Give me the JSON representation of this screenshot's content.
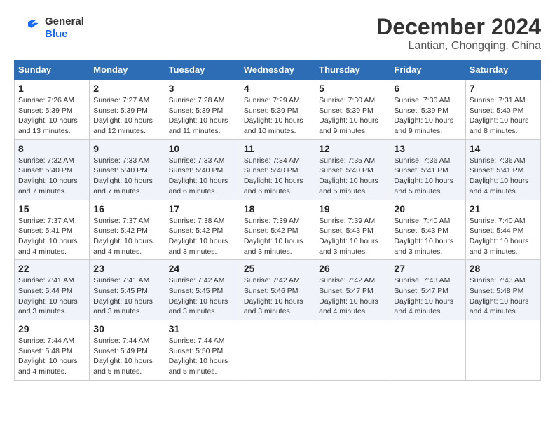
{
  "header": {
    "logo_line1": "General",
    "logo_line2": "Blue",
    "month": "December 2024",
    "location": "Lantian, Chongqing, China"
  },
  "weekdays": [
    "Sunday",
    "Monday",
    "Tuesday",
    "Wednesday",
    "Thursday",
    "Friday",
    "Saturday"
  ],
  "weeks": [
    [
      {
        "day": "1",
        "sunrise": "7:26 AM",
        "sunset": "5:39 PM",
        "daylight": "10 hours and 13 minutes."
      },
      {
        "day": "2",
        "sunrise": "7:27 AM",
        "sunset": "5:39 PM",
        "daylight": "10 hours and 12 minutes."
      },
      {
        "day": "3",
        "sunrise": "7:28 AM",
        "sunset": "5:39 PM",
        "daylight": "10 hours and 11 minutes."
      },
      {
        "day": "4",
        "sunrise": "7:29 AM",
        "sunset": "5:39 PM",
        "daylight": "10 hours and 10 minutes."
      },
      {
        "day": "5",
        "sunrise": "7:30 AM",
        "sunset": "5:39 PM",
        "daylight": "10 hours and 9 minutes."
      },
      {
        "day": "6",
        "sunrise": "7:30 AM",
        "sunset": "5:39 PM",
        "daylight": "10 hours and 9 minutes."
      },
      {
        "day": "7",
        "sunrise": "7:31 AM",
        "sunset": "5:40 PM",
        "daylight": "10 hours and 8 minutes."
      }
    ],
    [
      {
        "day": "8",
        "sunrise": "7:32 AM",
        "sunset": "5:40 PM",
        "daylight": "10 hours and 7 minutes."
      },
      {
        "day": "9",
        "sunrise": "7:33 AM",
        "sunset": "5:40 PM",
        "daylight": "10 hours and 7 minutes."
      },
      {
        "day": "10",
        "sunrise": "7:33 AM",
        "sunset": "5:40 PM",
        "daylight": "10 hours and 6 minutes."
      },
      {
        "day": "11",
        "sunrise": "7:34 AM",
        "sunset": "5:40 PM",
        "daylight": "10 hours and 6 minutes."
      },
      {
        "day": "12",
        "sunrise": "7:35 AM",
        "sunset": "5:40 PM",
        "daylight": "10 hours and 5 minutes."
      },
      {
        "day": "13",
        "sunrise": "7:36 AM",
        "sunset": "5:41 PM",
        "daylight": "10 hours and 5 minutes."
      },
      {
        "day": "14",
        "sunrise": "7:36 AM",
        "sunset": "5:41 PM",
        "daylight": "10 hours and 4 minutes."
      }
    ],
    [
      {
        "day": "15",
        "sunrise": "7:37 AM",
        "sunset": "5:41 PM",
        "daylight": "10 hours and 4 minutes."
      },
      {
        "day": "16",
        "sunrise": "7:37 AM",
        "sunset": "5:42 PM",
        "daylight": "10 hours and 4 minutes."
      },
      {
        "day": "17",
        "sunrise": "7:38 AM",
        "sunset": "5:42 PM",
        "daylight": "10 hours and 3 minutes."
      },
      {
        "day": "18",
        "sunrise": "7:39 AM",
        "sunset": "5:42 PM",
        "daylight": "10 hours and 3 minutes."
      },
      {
        "day": "19",
        "sunrise": "7:39 AM",
        "sunset": "5:43 PM",
        "daylight": "10 hours and 3 minutes."
      },
      {
        "day": "20",
        "sunrise": "7:40 AM",
        "sunset": "5:43 PM",
        "daylight": "10 hours and 3 minutes."
      },
      {
        "day": "21",
        "sunrise": "7:40 AM",
        "sunset": "5:44 PM",
        "daylight": "10 hours and 3 minutes."
      }
    ],
    [
      {
        "day": "22",
        "sunrise": "7:41 AM",
        "sunset": "5:44 PM",
        "daylight": "10 hours and 3 minutes."
      },
      {
        "day": "23",
        "sunrise": "7:41 AM",
        "sunset": "5:45 PM",
        "daylight": "10 hours and 3 minutes."
      },
      {
        "day": "24",
        "sunrise": "7:42 AM",
        "sunset": "5:45 PM",
        "daylight": "10 hours and 3 minutes."
      },
      {
        "day": "25",
        "sunrise": "7:42 AM",
        "sunset": "5:46 PM",
        "daylight": "10 hours and 3 minutes."
      },
      {
        "day": "26",
        "sunrise": "7:42 AM",
        "sunset": "5:47 PM",
        "daylight": "10 hours and 4 minutes."
      },
      {
        "day": "27",
        "sunrise": "7:43 AM",
        "sunset": "5:47 PM",
        "daylight": "10 hours and 4 minutes."
      },
      {
        "day": "28",
        "sunrise": "7:43 AM",
        "sunset": "5:48 PM",
        "daylight": "10 hours and 4 minutes."
      }
    ],
    [
      {
        "day": "29",
        "sunrise": "7:44 AM",
        "sunset": "5:48 PM",
        "daylight": "10 hours and 4 minutes."
      },
      {
        "day": "30",
        "sunrise": "7:44 AM",
        "sunset": "5:49 PM",
        "daylight": "10 hours and 5 minutes."
      },
      {
        "day": "31",
        "sunrise": "7:44 AM",
        "sunset": "5:50 PM",
        "daylight": "10 hours and 5 minutes."
      },
      null,
      null,
      null,
      null
    ]
  ]
}
